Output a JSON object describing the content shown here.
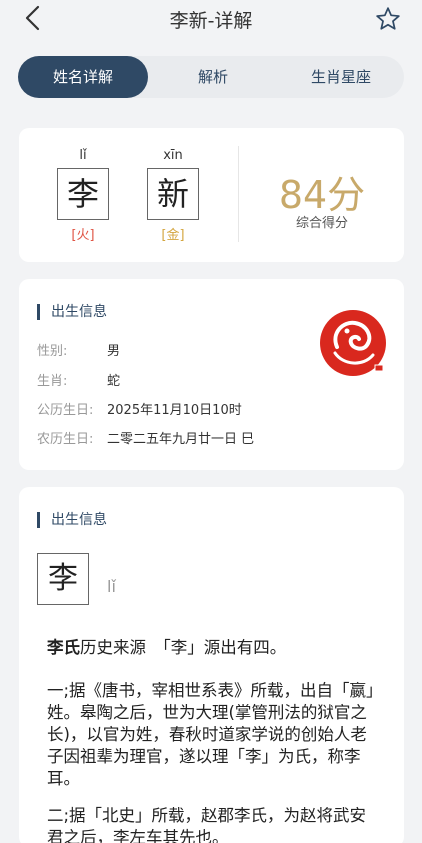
{
  "header": {
    "title": "李新-详解",
    "back_icon": "chevron-left-icon",
    "favorite_icon": "star-outline-icon"
  },
  "tabs": [
    {
      "label": "姓名详解",
      "active": true
    },
    {
      "label": "解析",
      "active": false
    },
    {
      "label": "生肖星座",
      "active": false
    }
  ],
  "name_chars": [
    {
      "char": "李",
      "pinyin": "lǐ",
      "element": "[火]",
      "element_color": "#e05545"
    },
    {
      "char": "新",
      "pinyin": "xīn",
      "element": "[金]",
      "element_color": "#d4a640"
    }
  ],
  "score": {
    "value": "84分",
    "label": "综合得分"
  },
  "birth_info": {
    "title": "出生信息",
    "rows": [
      {
        "label": "性别:",
        "value": "男"
      },
      {
        "label": "生肖:",
        "value": "蛇"
      },
      {
        "label": "公历生日:",
        "value": "2025年11月10日10时"
      },
      {
        "label": "农历生日:",
        "value": "二零二五年九月廿一日 巳"
      }
    ],
    "seal_icon": "snake-zodiac-seal-icon"
  },
  "history": {
    "title": "出生信息",
    "char": "李",
    "pinyin": "lǐ",
    "surname": "李氏",
    "heading_rest": "历史来源　「李」源出有四。",
    "para1": "一;据《唐书，宰相世系表》所载，出自「嬴」姓。皋陶之后，世为大理(掌管刑法的狱官之长)，以官为姓，春秋时道家学说的创始人老子因祖辈为理官，遂以理「李」为氏，称李耳。",
    "para2": "二;据「北史」所载，赵郡李氏，为赵将武安君之后，李左车其先也。"
  },
  "colors": {
    "accent": "#2f4965",
    "gold": "#c8a96a",
    "seal_red": "#d9281e"
  }
}
